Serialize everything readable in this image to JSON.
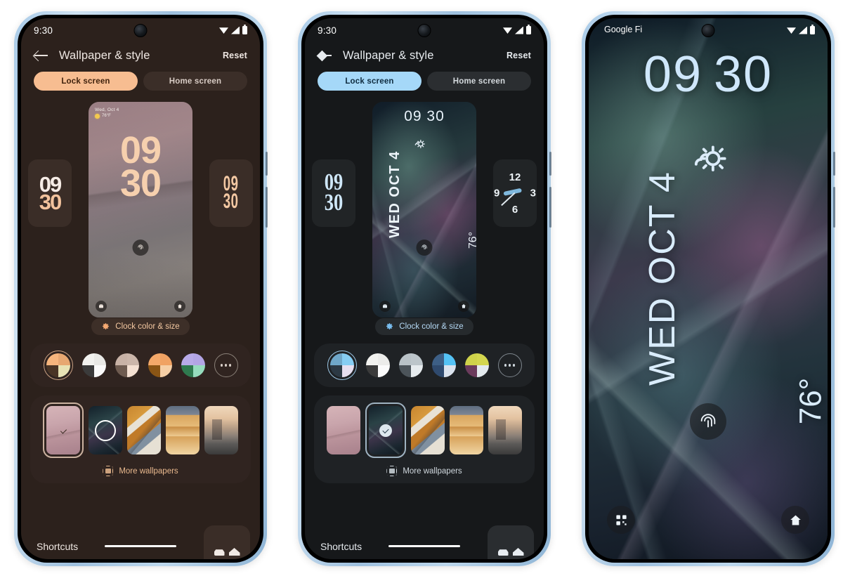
{
  "phone1": {
    "status": {
      "time": "9:30",
      "icons": [
        "wifi-icon",
        "signal-icon",
        "battery-icon"
      ]
    },
    "appbar": {
      "back": "back-arrow-icon",
      "title": "Wallpaper & style",
      "reset": "Reset"
    },
    "tabs": [
      {
        "label": "Lock screen",
        "active": true
      },
      {
        "label": "Home screen",
        "active": false
      }
    ],
    "carousel": {
      "left_clock": {
        "line1": "09",
        "line2": "30"
      },
      "right_clock": {
        "line1": "09",
        "line2": "30"
      },
      "preview": {
        "date": "Wed, Oct 4",
        "temp": "76°F",
        "weather_icon": "sun-icon",
        "clock_line1": "09",
        "clock_line2": "30",
        "fingerprint_icon": "fingerprint-icon",
        "left_shortcut_icon": "wallet-icon",
        "right_shortcut_icon": "home-icon"
      }
    },
    "clock_chip": {
      "label": "Clock color & size",
      "icon": "gear-icon"
    },
    "swatches": [
      {
        "name": "peach-theme",
        "selected": true,
        "colors": [
          "#f6b57d",
          "#e7a771",
          "#4a3526",
          "#e8e2b4"
        ]
      },
      {
        "name": "mono-theme",
        "selected": false,
        "colors": [
          "#f2f2ef",
          "#e9e9e6",
          "#3b3b3b",
          "#fafafa"
        ]
      },
      {
        "name": "taupe-theme",
        "selected": false,
        "colors": [
          "#c8b2a6",
          "#cbb6aa",
          "#6e5b50",
          "#f4e0d2"
        ]
      },
      {
        "name": "orange-theme",
        "selected": false,
        "colors": [
          "#f4a96a",
          "#f0a263",
          "#8a5515",
          "#f6cfa6"
        ]
      },
      {
        "name": "violet-theme",
        "selected": false,
        "colors": [
          "#b8aae8",
          "#b3a5e5",
          "#2f7a4f",
          "#96dcbd"
        ]
      }
    ],
    "more_swatches": "more-colors-button",
    "wallpapers": [
      {
        "name": "dunes-pink",
        "selected": true
      },
      {
        "name": "crystal",
        "selected": false
      },
      {
        "name": "abstract",
        "selected": false
      },
      {
        "name": "desert-dune",
        "selected": false
      },
      {
        "name": "cityscape",
        "selected": false
      }
    ],
    "more_wallpapers": {
      "label": "More wallpapers",
      "icon": "wallpaper-icon"
    },
    "footer": {
      "shortcuts": "Shortcuts",
      "nav_icons": [
        "google-icon",
        "home-icon"
      ]
    }
  },
  "phone2": {
    "status": {
      "time": "9:30",
      "icons": [
        "wifi-icon",
        "signal-icon",
        "battery-icon"
      ]
    },
    "appbar": {
      "back": "back-arrow-icon",
      "title": "Wallpaper & style",
      "reset": "Reset"
    },
    "tabs": [
      {
        "label": "Lock screen",
        "active": true
      },
      {
        "label": "Home screen",
        "active": false
      }
    ],
    "carousel": {
      "left_clock": {
        "line1": "09",
        "line2": "30"
      },
      "right_clock": {
        "type": "analog",
        "numerals": [
          "12",
          "3",
          "6",
          "9"
        ]
      },
      "preview": {
        "time": "09 30",
        "date": "WED OCT 4",
        "temp": "76°",
        "weather_icon": "sun-icon",
        "fingerprint_icon": "fingerprint-icon",
        "left_shortcut_icon": "wallet-icon",
        "right_shortcut_icon": "home-icon"
      }
    },
    "clock_chip": {
      "label": "Clock color & size",
      "icon": "gear-icon"
    },
    "swatches": [
      {
        "name": "blue-theme",
        "selected": true,
        "colors": [
          "#6fa7c9",
          "#86cdf3",
          "#2c3944",
          "#e7dff0"
        ]
      },
      {
        "name": "mono-theme",
        "selected": false,
        "colors": [
          "#f2f2ef",
          "#ececea",
          "#3b3b3b",
          "#fbfbfb"
        ]
      },
      {
        "name": "gray-theme",
        "selected": false,
        "colors": [
          "#b9c2c7",
          "#bcc5ca",
          "#4c545a",
          "#e6ebee"
        ]
      },
      {
        "name": "skyblue-theme",
        "selected": false,
        "colors": [
          "#3d5f86",
          "#54c2f5",
          "#2f4a6e",
          "#dbe3ee"
        ]
      },
      {
        "name": "lime-theme",
        "selected": false,
        "colors": [
          "#cfd24a",
          "#d3d64e",
          "#6b3b5c",
          "#e3eaee"
        ]
      }
    ],
    "more_swatches": "more-colors-button",
    "wallpapers": [
      {
        "name": "dunes-pink",
        "selected": false
      },
      {
        "name": "crystal",
        "selected": true
      },
      {
        "name": "abstract",
        "selected": false
      },
      {
        "name": "desert-dune",
        "selected": false
      },
      {
        "name": "cityscape",
        "selected": false
      }
    ],
    "more_wallpapers": {
      "label": "More wallpapers",
      "icon": "wallpaper-icon"
    },
    "footer": {
      "shortcuts": "Shortcuts",
      "nav_icons": [
        "google-icon",
        "home-icon"
      ]
    }
  },
  "phone3": {
    "status": {
      "carrier": "Google Fi",
      "icons": [
        "wifi-icon",
        "signal-icon",
        "battery-icon"
      ]
    },
    "lockscreen": {
      "time_hours": "09",
      "time_minutes": "30",
      "date": "WED OCT 4",
      "temp": "76°",
      "weather_icon": "sun-icon",
      "fingerprint_icon": "fingerprint-icon",
      "qr_icon": "qr-scanner-icon",
      "home_icon": "home-icon"
    }
  }
}
